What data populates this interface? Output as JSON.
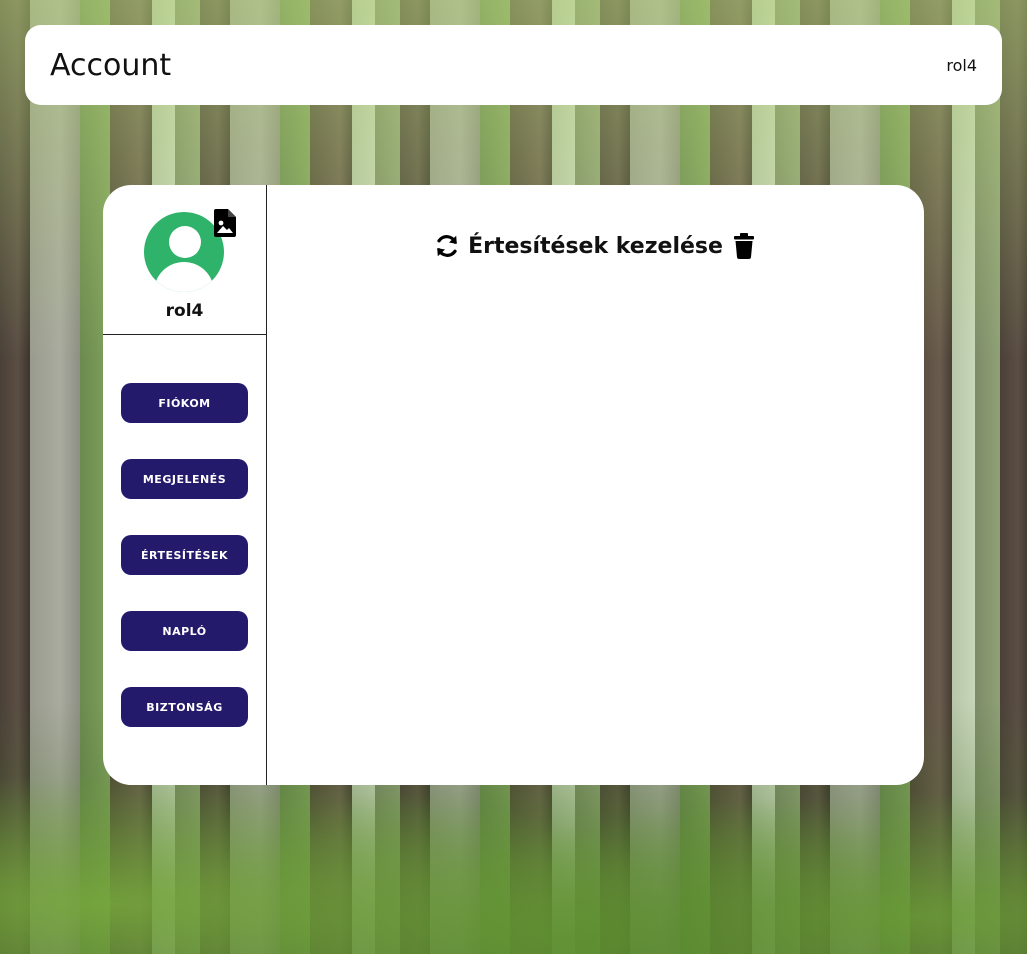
{
  "header": {
    "title": "Account",
    "username": "rol4"
  },
  "profile": {
    "name": "rol4",
    "avatar_icon": "user-avatar-icon",
    "upload_icon": "image-file-icon",
    "avatar_color": "#2fb36a"
  },
  "sidebar": {
    "items": [
      {
        "label": "FIÓKOM"
      },
      {
        "label": "MEGJELENÉS"
      },
      {
        "label": "ÉRTESÍTÉSEK"
      },
      {
        "label": "NAPLÓ"
      },
      {
        "label": "BIZTONSÁG"
      }
    ],
    "button_color": "#241a6b"
  },
  "main": {
    "title": "Értesítések kezelése",
    "refresh_icon": "refresh-icon",
    "delete_icon": "trash-icon"
  }
}
